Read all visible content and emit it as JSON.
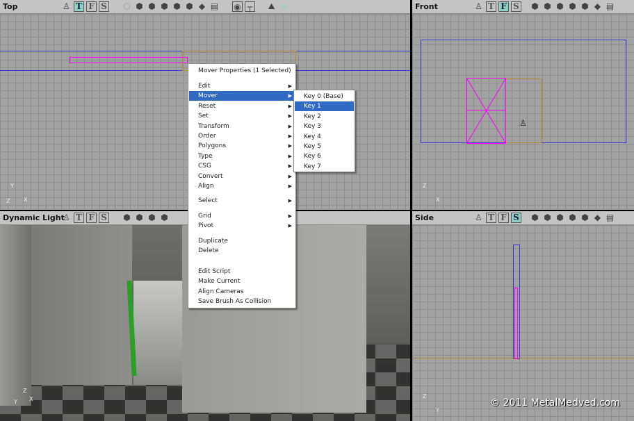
{
  "viewports": {
    "top": {
      "title": "Top",
      "active": "T"
    },
    "front": {
      "title": "Front",
      "active": "F"
    },
    "persp": {
      "title": "Dynamic Light"
    },
    "side": {
      "title": "Side",
      "active": "S"
    }
  },
  "toolbar": {
    "t": "T",
    "f": "F",
    "s": "S",
    "icons": [
      "actor-icon",
      "wireframe-icon",
      "zone-icon",
      "texture-usage-icon",
      "bsp-icon",
      "solid-icon",
      "lit-icon",
      "dynamic-light-icon",
      "brush-icon",
      "realtime-icon",
      "lock-icon",
      "terrain-icon",
      "show-grid-icon"
    ]
  },
  "axes": {
    "x": "X",
    "y": "Y",
    "z": "Z"
  },
  "context_menu": {
    "header": "Mover Properties (1 Selected)",
    "group1": [
      "Edit",
      "Mover",
      "Reset",
      "Set",
      "Transform",
      "Order",
      "Polygons",
      "Type",
      "CSG",
      "Convert",
      "Align"
    ],
    "selected": "Mover",
    "select": "Select",
    "group2": [
      "Grid",
      "Pivot"
    ],
    "group3": [
      "Duplicate",
      "Delete"
    ],
    "group4": [
      "Edit Script",
      "Make Current",
      "Align Cameras",
      "Save Brush As Collision"
    ]
  },
  "submenu": {
    "items": [
      "Key 0 (Base)",
      "Key 1",
      "Key 2",
      "Key 3",
      "Key 4",
      "Key 5",
      "Key 6",
      "Key 7"
    ],
    "selected": "Key 1"
  },
  "watermark": "© 2011 MetalMedved.com",
  "colors": {
    "selection": "#316ac5",
    "brush": "#ff00ff",
    "active_view": "#8fd1c0"
  }
}
